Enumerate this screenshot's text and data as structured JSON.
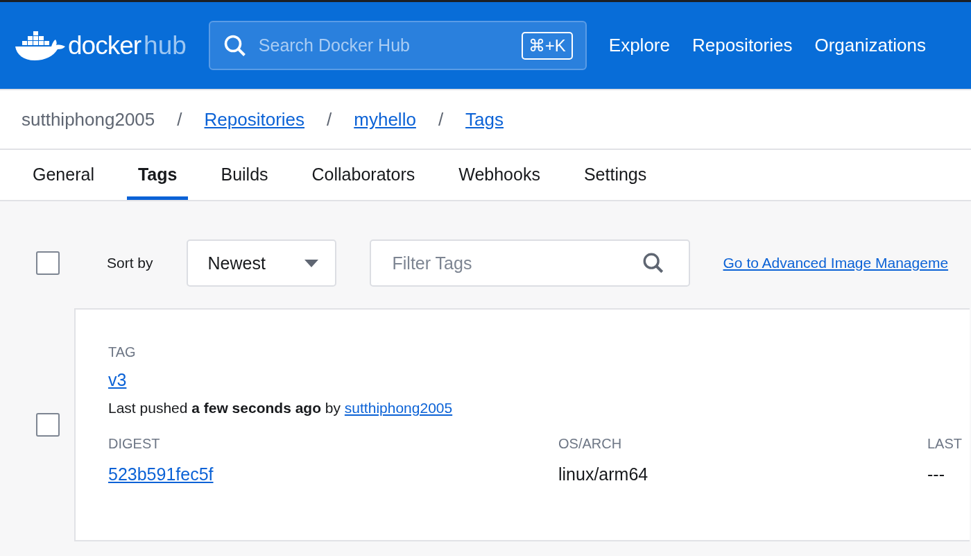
{
  "header": {
    "logo": {
      "word": "docker",
      "suffix": "hub"
    },
    "search": {
      "placeholder": "Search Docker Hub",
      "shortcut": "⌘+K"
    },
    "nav": [
      "Explore",
      "Repositories",
      "Organizations"
    ]
  },
  "breadcrumb": [
    {
      "label": "sutthiphong2005",
      "link": false
    },
    {
      "label": "Repositories",
      "link": true,
      "separator": "/"
    },
    {
      "label": "myhello",
      "link": true,
      "separator": "/"
    },
    {
      "label": "Tags",
      "link": true,
      "separator": "/"
    }
  ],
  "tabs": [
    {
      "label": "General",
      "selected": false
    },
    {
      "label": "Tags",
      "selected": true
    },
    {
      "label": "Builds",
      "selected": false
    },
    {
      "label": "Collaborators",
      "selected": false
    },
    {
      "label": "Webhooks",
      "selected": false
    },
    {
      "label": "Settings",
      "selected": false
    }
  ],
  "toolbar": {
    "select_all": {
      "checked": false
    },
    "sort_label": "Sort by",
    "sort": {
      "value": "Newest"
    },
    "filter": {
      "placeholder": "Filter Tags"
    },
    "link": "Go to Advanced Image Manageme"
  },
  "tags": [
    {
      "checked": false,
      "heading": "TAG",
      "name": "v3",
      "pushed": "Last pushed **a few seconds ago** by",
      "pusher": "sutthiphong2005",
      "columns": [
        {
          "heading": "DIGEST",
          "value": "523b591fec5f",
          "kind": "link"
        },
        {
          "heading": "OS/ARCH",
          "value": "linux/arm64",
          "kind": "text"
        },
        {
          "heading": "LAST",
          "value": "---",
          "kind": "text"
        }
      ]
    }
  ]
}
